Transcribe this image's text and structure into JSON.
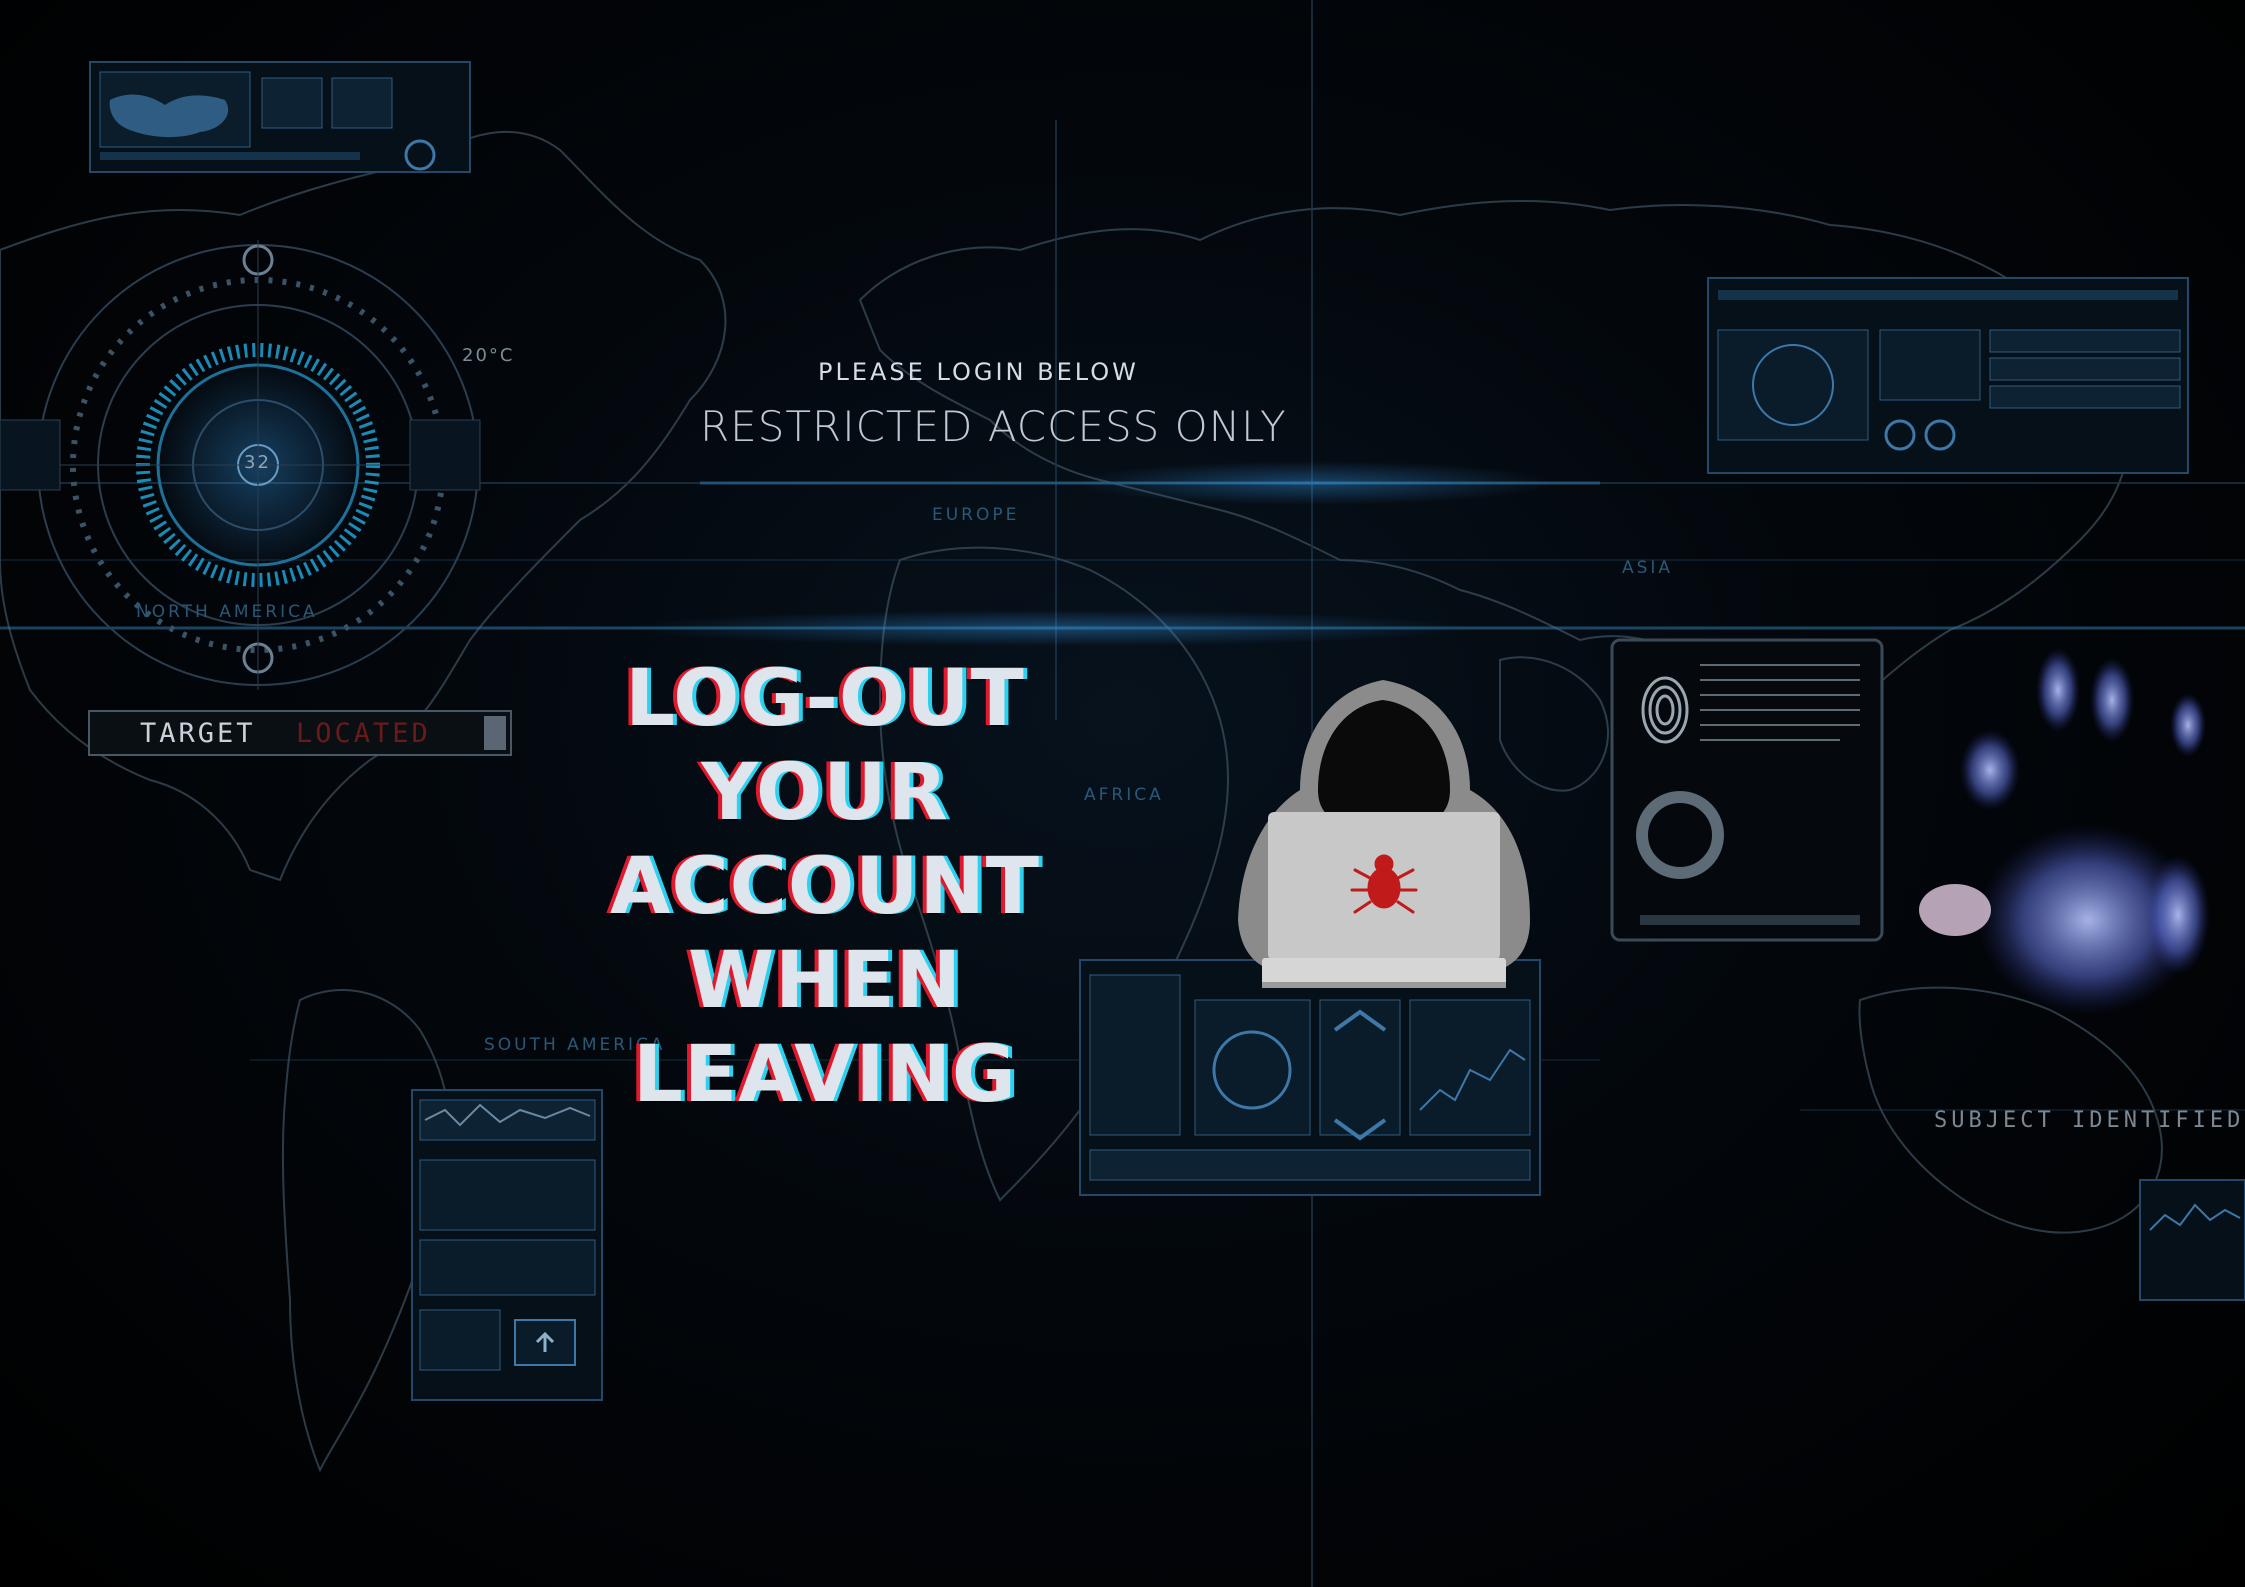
{
  "hud": {
    "please_login": "PLEASE LOGIN BELOW",
    "restricted": "RESTRICTED ACCESS ONLY",
    "target_prefix": "TARGET",
    "target_status": "LOCATED",
    "subject": "SUBJECT IDENTIFIED",
    "temperature": "20°C",
    "dial_value": "32"
  },
  "regions": {
    "europe": "EUROPE",
    "asia": "ASIA",
    "africa": "AFRICA",
    "north_america": "NORTH AMERICA",
    "south_america": "SOUTH AMERICA"
  },
  "headline": {
    "line1": "LOG-OUT",
    "line2": "YOUR ACCOUNT",
    "line3": "WHEN LEAVING"
  },
  "colors": {
    "accent_red": "#e2182c",
    "accent_cyan": "#2ad2f0",
    "hud_blue": "#1f6f9a",
    "fingerprint": "#8fa6ff"
  },
  "icons": [
    "world-map-icon",
    "radar-dial-icon",
    "hooded-hacker-icon",
    "laptop-icon",
    "bug-icon",
    "fingerprint-icon",
    "handprint-icon"
  ]
}
